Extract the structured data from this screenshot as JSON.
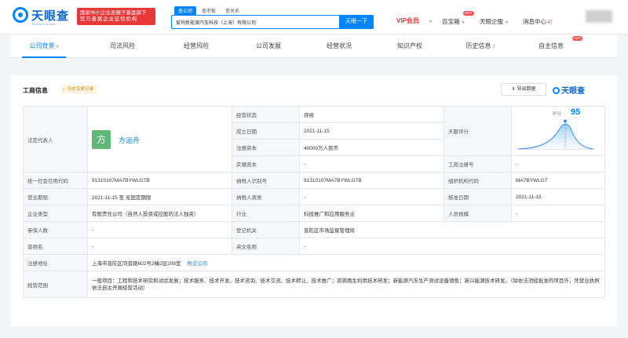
{
  "header": {
    "logo_text": "天眼查",
    "logo_sub": "TianYanCha.com",
    "promo_line1": "国家中小企业发展子基金旗下",
    "promo_line2": "官方备案企业征信机构",
    "search_tabs": [
      "查公司",
      "查老板",
      "查关系"
    ],
    "search_value": "爱玛新能源汽车科技（上海）有限公司",
    "search_button": "天眼一下",
    "nav": {
      "vip": "VIP会员",
      "app": "百宝箱",
      "app_badge": "HOT",
      "enterprise": "天眼企服",
      "message": "消息中心",
      "message_count": "47"
    }
  },
  "company_nav": [
    {
      "label": "公司背景",
      "count": "4"
    },
    {
      "label": "司法风险",
      "count": ""
    },
    {
      "label": "经营风险",
      "count": ""
    },
    {
      "label": "公司发展",
      "count": ""
    },
    {
      "label": "经营状况",
      "count": ""
    },
    {
      "label": "知识产权",
      "count": ""
    },
    {
      "label": "历史信息",
      "count": "2"
    },
    {
      "label": "自主信息",
      "count": "",
      "badge": "HOT"
    }
  ],
  "section": {
    "title": "工商信息",
    "badge": "历史变更记录",
    "export": "导出数据",
    "watermark": "天眼查"
  },
  "business_info": {
    "legal_rep_label": "法定代表人",
    "legal_rep_avatar": "方",
    "legal_rep_name": "方运舟",
    "status_label": "经营状态",
    "status": "存续",
    "est_date_label": "成立日期",
    "est_date": "2021-11-15",
    "reg_capital_label": "注册资本",
    "reg_capital": "40000万人民币",
    "paid_capital_label": "实缴资本",
    "paid_capital": "-",
    "score_label": "天眼评分",
    "score_title": "评分",
    "score": "95",
    "reg_no_label": "工商注册号",
    "reg_no": "-",
    "credit_code_label": "统一社会信用代码",
    "credit_code": "91310107MA7BYWLG7B",
    "taxpayer_id_label": "纳税人识别号",
    "taxpayer_id": "91310107MA7BYWLG7B",
    "org_code_label": "组织机构代码",
    "org_code": "MA7BYWLG7",
    "term_label": "营业期限",
    "term": "2021-11-15 至 无固定期限",
    "taxpayer_qual_label": "纳税人资质",
    "taxpayer_qual": "-",
    "approval_date_label": "核准日期",
    "approval_date": "2021-11-15",
    "company_type_label": "企业类型",
    "company_type": "有限责任公司（自然人投资或控股的法人独资）",
    "industry_label": "行业",
    "industry": "科技推广和应用服务业",
    "staff_size_label": "人员规模",
    "staff_size": "-",
    "insured_label": "参保人数",
    "insured": "-",
    "registry_label": "登记机关",
    "registry": "普陀区市场监督管理局",
    "former_name_label": "曾用名",
    "former_name": "-",
    "english_name_label": "英文名称",
    "english_name": "-",
    "address_label": "注册地址",
    "address": "上海市普陀区同普路602号2幢2层209室",
    "address_link": "附近公司",
    "scope_label": "经营范围",
    "scope": "一般项目：工程和技术研究和试验发展；技术服务、技术开发、技术咨询、技术交流、技术转让、技术推广；资源再生利用技术研发；新能源汽车生产测试设备销售；新兴能源技术研发。（除依法须经批准的项目外，凭营业执照依法自主开展经营活动）"
  },
  "colors": {
    "brand": "#0084ff",
    "promo": "#e8393a",
    "vip": "#e8393a"
  }
}
